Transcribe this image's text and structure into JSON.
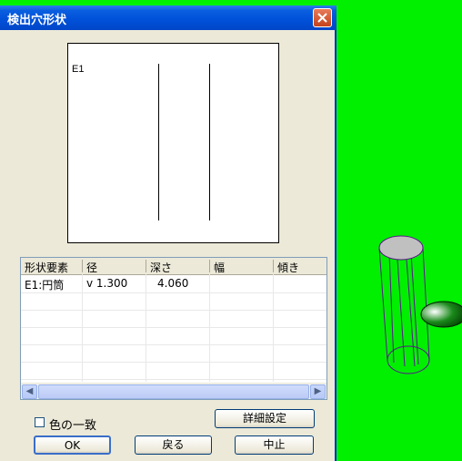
{
  "dialog": {
    "title": "検出穴形状",
    "preview_label": "E1"
  },
  "table": {
    "columns": [
      "形状要素",
      "径",
      "深さ",
      "幅",
      "傾き"
    ],
    "rows": [
      {
        "element": "E1:円筒",
        "diameter": "v 1.300",
        "depth": "4.060",
        "width": "",
        "tilt": ""
      }
    ]
  },
  "options": {
    "color_match_label": "色の一致",
    "color_match_checked": false
  },
  "buttons": {
    "detail_settings": "詳細設定",
    "ok": "OK",
    "back": "戻る",
    "cancel": "中止"
  },
  "colors": {
    "viewport_background": "#00f000",
    "titlebar": "#0050d8"
  }
}
